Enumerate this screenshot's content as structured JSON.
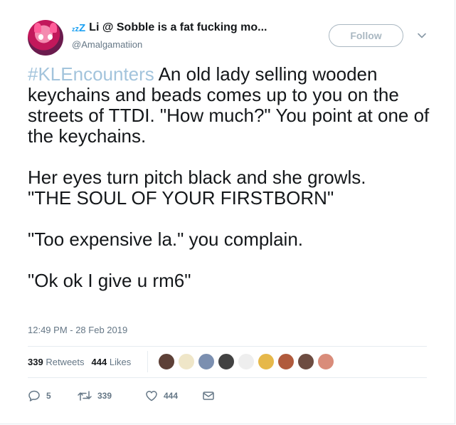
{
  "user": {
    "display_name": "Li @ Sobble is a fat fucking mo...",
    "handle": "@Amalgamatiion",
    "status_icon": "zzz-sleep-icon"
  },
  "follow_button": {
    "label": "Follow"
  },
  "tweet": {
    "hashtag": "#KLEncounters",
    "paragraph_1_rest": " An old lady selling wooden keychains and beads comes up to you on the streets of TTDI. \"How much?\" You point at one of the keychains.",
    "paragraph_2_line_1": "Her eyes turn pitch black and she growls.",
    "paragraph_2_line_2": "\"THE SOUL OF YOUR FIRSTBORN\"",
    "paragraph_3": "\"Too expensive la.\" you complain.",
    "paragraph_4": "\"Ok ok I give u rm6\"",
    "timestamp": "12:49 PM - 28 Feb 2019"
  },
  "stats": {
    "retweets_count": "339",
    "retweets_label": "Retweets",
    "likes_count": "444",
    "likes_label": "Likes"
  },
  "likers": [
    {
      "color": "#5d4037"
    },
    {
      "color": "#efe6c8"
    },
    {
      "color": "#7b8fb0"
    },
    {
      "color": "#424242"
    },
    {
      "color": "#eeeeee"
    },
    {
      "color": "#e6b84a"
    },
    {
      "color": "#b05a3c"
    },
    {
      "color": "#6d4c41"
    },
    {
      "color": "#d98c7a"
    }
  ],
  "actions": {
    "reply_count": "5",
    "retweet_count": "339",
    "like_count": "444"
  },
  "colors": {
    "accent": "#1da1f2",
    "muted": "#657786",
    "hashtag": "#a3c4dc"
  }
}
